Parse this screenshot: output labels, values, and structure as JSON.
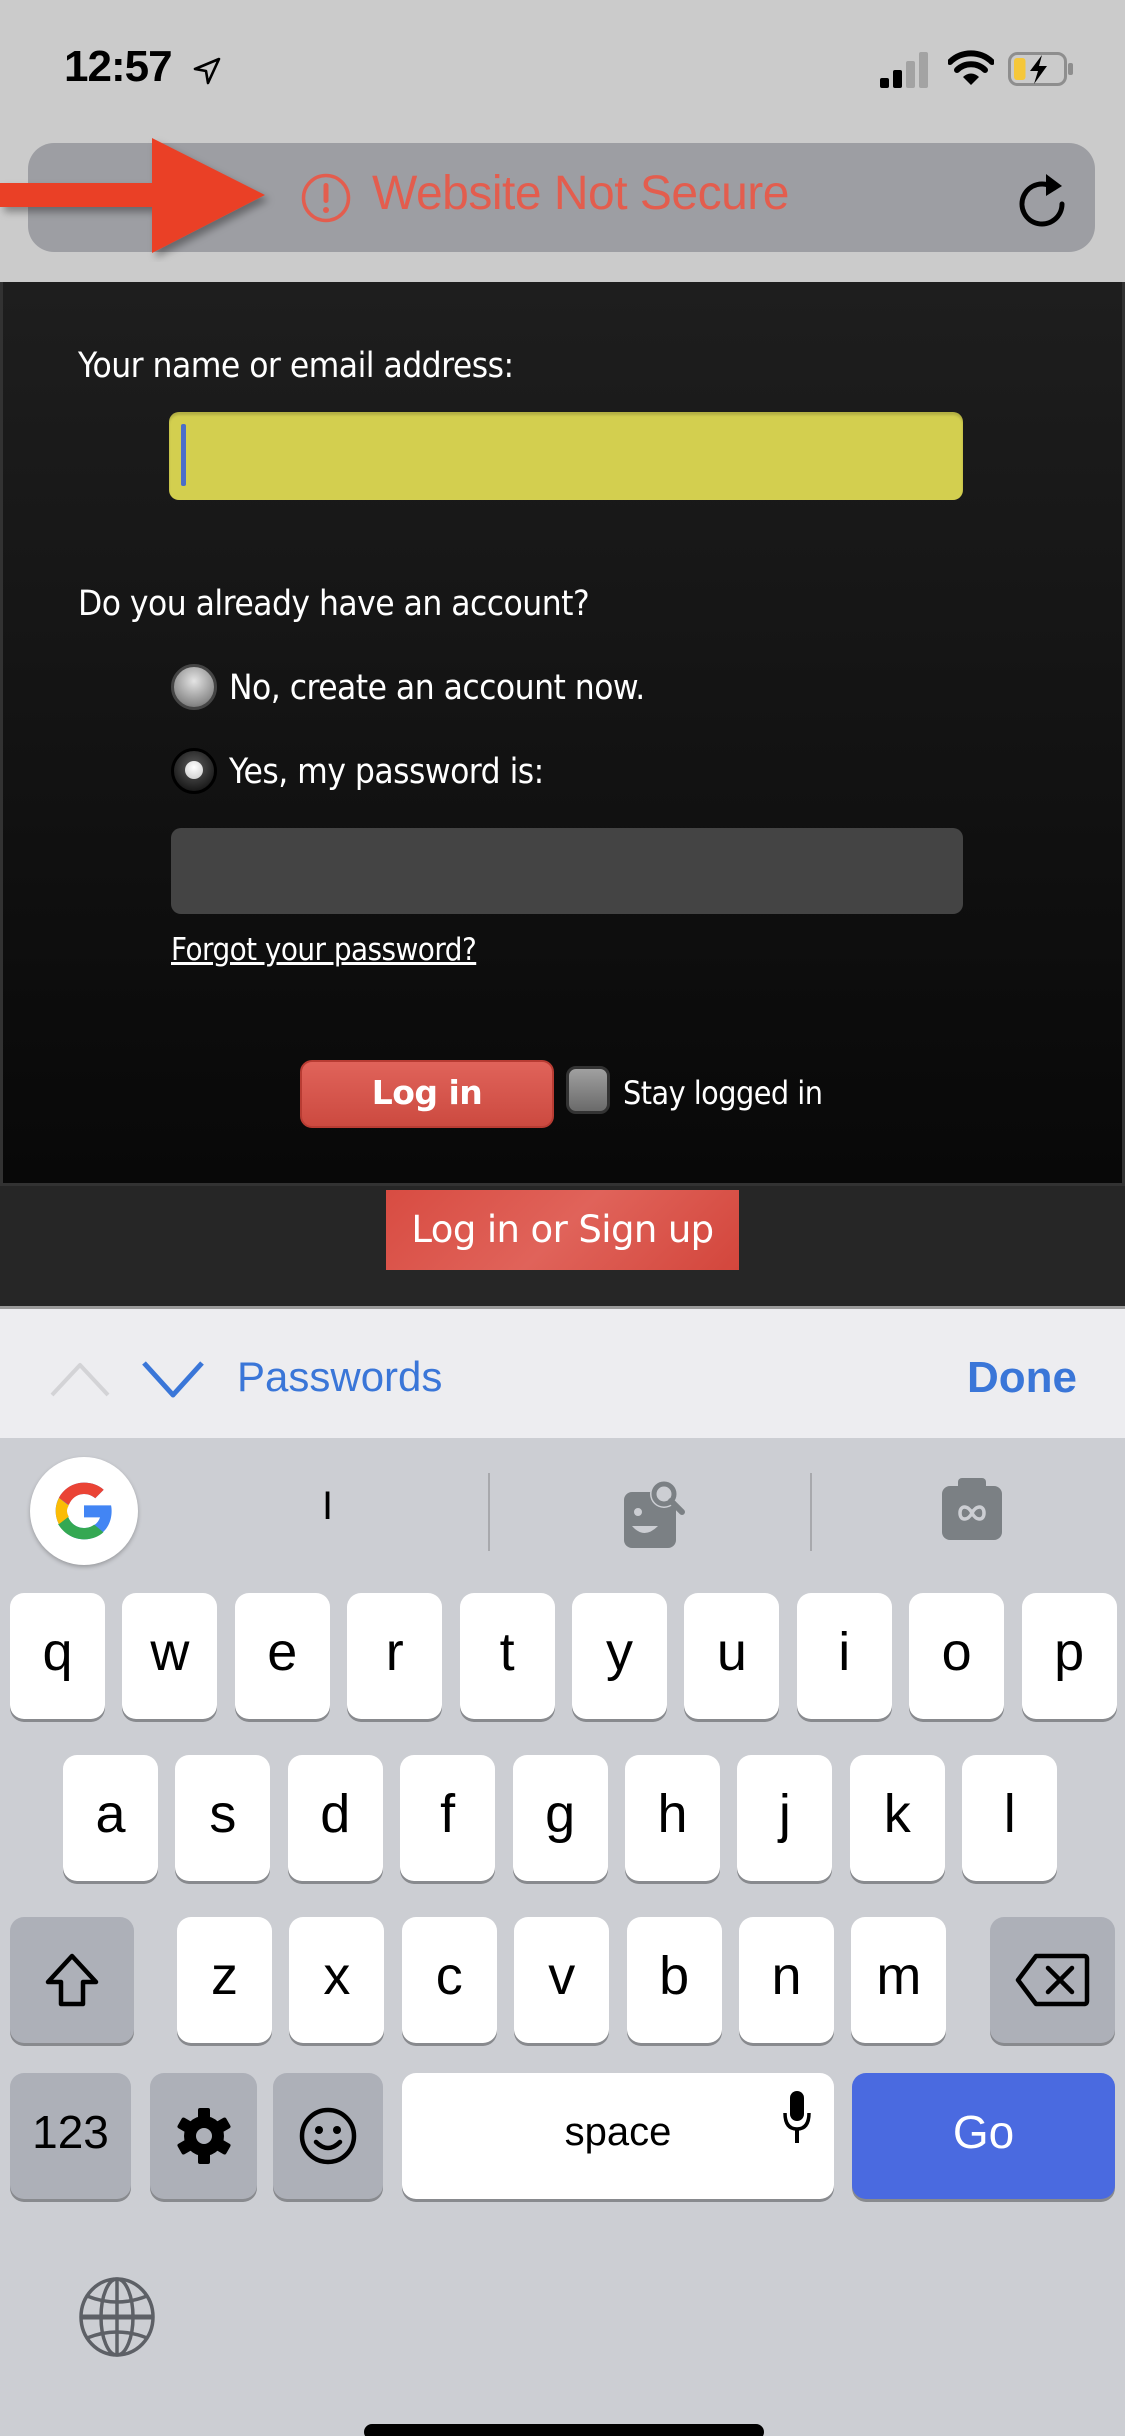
{
  "status_bar": {
    "time": "12:57",
    "location_icon": "location-arrow-icon",
    "signal_icon": "cellular-signal-icon",
    "signal_bars_active": 2,
    "signal_bars_total": 4,
    "wifi_icon": "wifi-icon",
    "battery_icon": "battery-charging-icon",
    "battery_level": 0.25,
    "battery_fill_color": "#f5c73a"
  },
  "browser": {
    "security_icon": "warning-circle-icon",
    "address_text": "Website Not Secure",
    "address_color": "#e35d4e",
    "reload_icon": "reload-icon",
    "annotation": "red-arrow-annotation",
    "annotation_color": "#ea4128"
  },
  "form": {
    "name_label": "Your name or email address:",
    "name_value": "",
    "name_field_color": "#d3cf4f",
    "account_question": "Do you already have an account?",
    "radio_options": [
      {
        "label": "No, create an account now.",
        "selected": false
      },
      {
        "label": "Yes, my password is:",
        "selected": true
      }
    ],
    "password_value": "",
    "forgot_link": "Forgot your password?",
    "login_button": "Log in",
    "stay_logged_in_label": "Stay logged in",
    "stay_logged_in_checked": false,
    "accent_color": "#d84c42"
  },
  "footer": {
    "signup_button": "Log in or Sign up"
  },
  "accessory_bar": {
    "prev_icon": "chevron-up-icon",
    "prev_enabled": false,
    "next_icon": "chevron-down-icon",
    "passwords_label": "Passwords",
    "done_label": "Done",
    "link_color": "#3a76d8"
  },
  "keyboard": {
    "toolbar": {
      "google_icon": "google-g-icon",
      "suggestion": "I",
      "image_search_icon": "image-search-icon",
      "lens_icon": "google-lens-icon"
    },
    "rows": [
      [
        "q",
        "w",
        "e",
        "r",
        "t",
        "y",
        "u",
        "i",
        "o",
        "p"
      ],
      [
        "a",
        "s",
        "d",
        "f",
        "g",
        "h",
        "j",
        "k",
        "l"
      ],
      [
        "z",
        "x",
        "c",
        "v",
        "b",
        "n",
        "m"
      ]
    ],
    "shift_icon": "shift-icon",
    "backspace_icon": "backspace-icon",
    "numbers_label": "123",
    "settings_icon": "gear-icon",
    "emoji_icon": "emoji-icon",
    "space_label": "space",
    "mic_icon": "microphone-icon",
    "go_label": "Go",
    "go_color": "#4a6ae0",
    "globe_icon": "globe-icon"
  }
}
